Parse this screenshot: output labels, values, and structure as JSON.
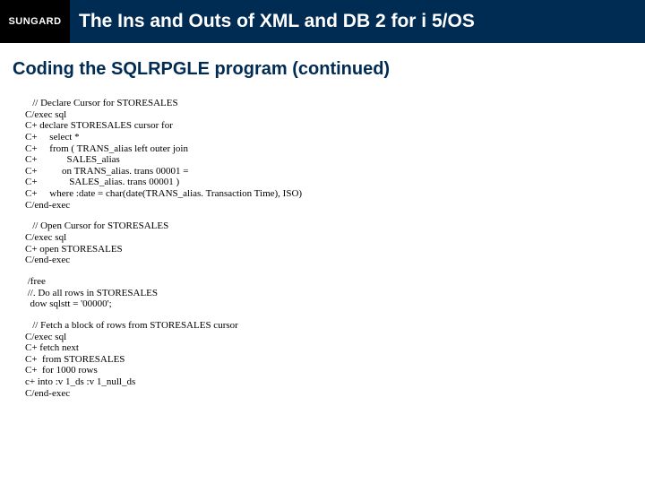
{
  "header": {
    "logo": "SUNGARD",
    "title": "The Ins and Outs of XML and DB 2 for i 5/OS"
  },
  "subtitle": "Coding the SQLRPGLE program (continued)",
  "code": {
    "block1": [
      "   // Declare Cursor for STORESALES",
      "C/exec sql",
      "C+ declare STORESALES cursor for",
      "C+     select *",
      "C+     from ( TRANS_alias left outer join",
      "C+            SALES_alias",
      "C+          on TRANS_alias. trans 00001 =",
      "C+             SALES_alias. trans 00001 )",
      "C+     where :date = char(date(TRANS_alias. Transaction Time), ISO)",
      "C/end-exec"
    ],
    "block2": [
      "   // Open Cursor for STORESALES",
      "C/exec sql",
      "C+ open STORESALES",
      "C/end-exec"
    ],
    "block3": [
      " /free",
      " //. Do all rows in STORESALES",
      "  dow sqlstt = '00000';"
    ],
    "block4": [
      "   // Fetch a block of rows from STORESALES cursor",
      "C/exec sql",
      "C+ fetch next",
      "C+  from STORESALES",
      "C+  for 1000 rows",
      "c+ into :v 1_ds :v 1_null_ds",
      "C/end-exec"
    ]
  }
}
